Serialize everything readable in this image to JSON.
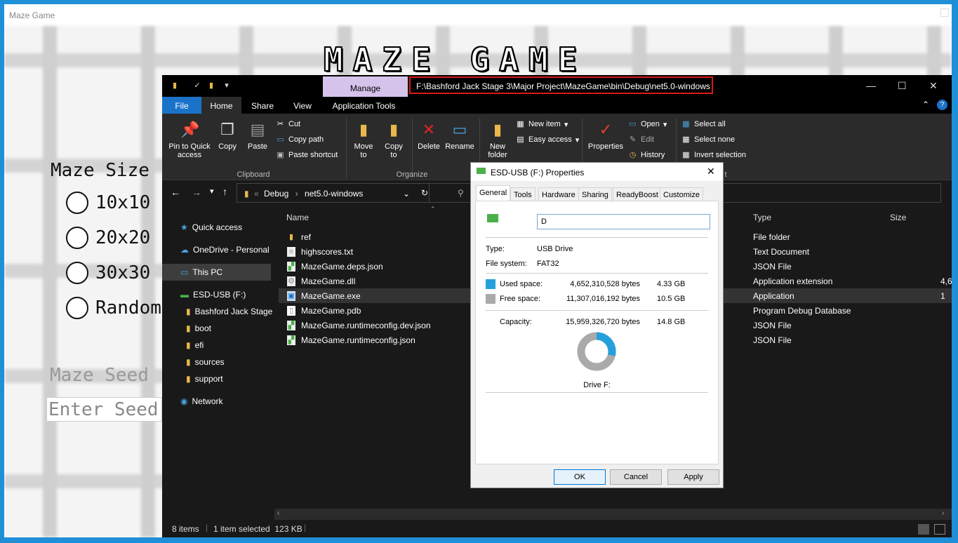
{
  "maze_window": {
    "title": "Maze Game",
    "game_title": "MAZE GAME",
    "maze_size_label": "Maze Size",
    "size_options": [
      "10x10",
      "20x20",
      "30x30",
      "Random"
    ],
    "seed_label": "Maze Seed",
    "seed_placeholder": "Enter Seed"
  },
  "explorer": {
    "manage_label": "Manage",
    "window_path": "F:\\Bashford Jack Stage 3\\Major Project\\MazeGame\\bin\\Debug\\net5.0-windows",
    "ribbon_tabs": [
      "File",
      "Home",
      "Share",
      "View",
      "Application Tools"
    ],
    "clipboard": {
      "pin": "Pin to Quick access",
      "copy": "Copy",
      "paste": "Paste",
      "cut": "Cut",
      "copy_path": "Copy path",
      "paste_shortcut": "Paste shortcut",
      "label": "Clipboard"
    },
    "organize": {
      "move_to": "Move to",
      "copy_to": "Copy to",
      "delete": "Delete",
      "rename": "Rename",
      "label": "Organize"
    },
    "new_group": {
      "new_folder": "New folder",
      "new_item": "New item",
      "easy_access": "Easy access"
    },
    "open_group": {
      "properties": "Properties",
      "open": "Open",
      "edit": "Edit",
      "history": "History"
    },
    "select_group": {
      "select_all": "Select all",
      "select_none": "Select none",
      "invert": "Invert selection",
      "label_fragment": "t"
    },
    "breadcrumb": [
      "Debug",
      "net5.0-windows"
    ],
    "nav": [
      {
        "label": "Quick access",
        "icon": "star-icon"
      },
      {
        "label": "OneDrive - Personal",
        "icon": "cloud-icon"
      },
      {
        "label": "This PC",
        "icon": "computer-icon"
      },
      {
        "label": "ESD-USB (F:)",
        "icon": "drive-icon"
      },
      {
        "label": "Bashford Jack Stage",
        "icon": "folder-icon"
      },
      {
        "label": "boot",
        "icon": "folder-icon"
      },
      {
        "label": "efi",
        "icon": "folder-icon"
      },
      {
        "label": "sources",
        "icon": "folder-icon"
      },
      {
        "label": "support",
        "icon": "folder-icon"
      },
      {
        "label": "Network",
        "icon": "network-icon"
      }
    ],
    "columns": {
      "name": "Name",
      "type": "Type",
      "size": "Size"
    },
    "files": [
      {
        "name": "ref",
        "type": "File folder",
        "size": "",
        "icon": "folder-icon"
      },
      {
        "name": "highscores.txt",
        "type": "Text Document",
        "size": "",
        "icon": "text-file-icon"
      },
      {
        "name": "MazeGame.deps.json",
        "type": "JSON File",
        "size": "",
        "icon": "json-file-icon"
      },
      {
        "name": "MazeGame.dll",
        "type": "Application extension",
        "size": "4,6",
        "icon": "dll-file-icon"
      },
      {
        "name": "MazeGame.exe",
        "type": "Application",
        "size": "1",
        "icon": "exe-file-icon"
      },
      {
        "name": "MazeGame.pdb",
        "type": "Program Debug Database",
        "size": "",
        "icon": "pdb-file-icon"
      },
      {
        "name": "MazeGame.runtimeconfig.dev.json",
        "type": "JSON File",
        "size": "",
        "icon": "json-file-icon"
      },
      {
        "name": "MazeGame.runtimeconfig.json",
        "type": "JSON File",
        "size": "",
        "icon": "json-file-icon"
      }
    ],
    "status": {
      "items": "8 items",
      "selected": "1 item selected  123 KB"
    }
  },
  "properties": {
    "title": "ESD-USB (F:) Properties",
    "tabs": [
      "General",
      "Tools",
      "Hardware",
      "Sharing",
      "ReadyBoost",
      "Customize"
    ],
    "name_value": "D",
    "type_label": "Type:",
    "type_value": "USB Drive",
    "fs_label": "File system:",
    "fs_value": "FAT32",
    "used_label": "Used space:",
    "used_bytes": "4,652,310,528 bytes",
    "used_gb": "4.33 GB",
    "free_label": "Free space:",
    "free_bytes": "11,307,016,192 bytes",
    "free_gb": "10.5 GB",
    "capacity_label": "Capacity:",
    "capacity_bytes": "15,959,326,720 bytes",
    "capacity_gb": "14.8 GB",
    "drive_label": "Drive F:",
    "used_fraction": 0.29,
    "used_color": "#26a0da",
    "free_color": "#aaaaaa",
    "buttons": {
      "ok": "OK",
      "cancel": "Cancel",
      "apply": "Apply"
    }
  }
}
